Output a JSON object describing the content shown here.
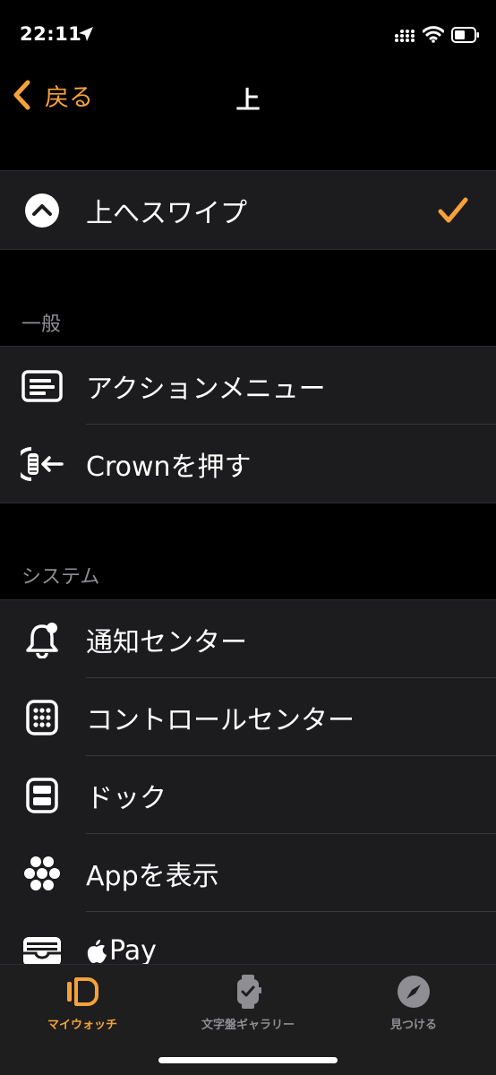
{
  "status_bar": {
    "time": "22:11"
  },
  "nav": {
    "back_label": "戻る",
    "title": "上"
  },
  "selected_row": {
    "label": "上へスワイプ",
    "icon": "chevron-up-circle-icon",
    "checked": true
  },
  "sections": [
    {
      "header": "一般",
      "items": [
        {
          "label": "アクションメニュー",
          "icon": "action-menu-icon"
        },
        {
          "label": "Crownを押す",
          "icon": "crown-press-icon"
        }
      ]
    },
    {
      "header": "システム",
      "items": [
        {
          "label": "通知センター",
          "icon": "bell-icon"
        },
        {
          "label": "コントロールセンター",
          "icon": "control-center-icon"
        },
        {
          "label": "ドック",
          "icon": "dock-icon"
        },
        {
          "label": "Appを表示",
          "icon": "app-grid-icon"
        },
        {
          "label": "Pay",
          "icon": "wallet-icon"
        }
      ]
    }
  ],
  "tab_bar": {
    "tabs": [
      {
        "label": "マイウォッチ",
        "icon": "watch-icon",
        "active": true
      },
      {
        "label": "文字盤ギャラリー",
        "icon": "watch-face-icon",
        "active": false
      },
      {
        "label": "見つける",
        "icon": "compass-icon",
        "active": false
      }
    ]
  },
  "colors": {
    "accent": "#f5a23a",
    "background": "#000000",
    "cell": "#1c1c1e",
    "secondary_text": "#8e8e93",
    "inactive_tab": "#8e8e93"
  }
}
